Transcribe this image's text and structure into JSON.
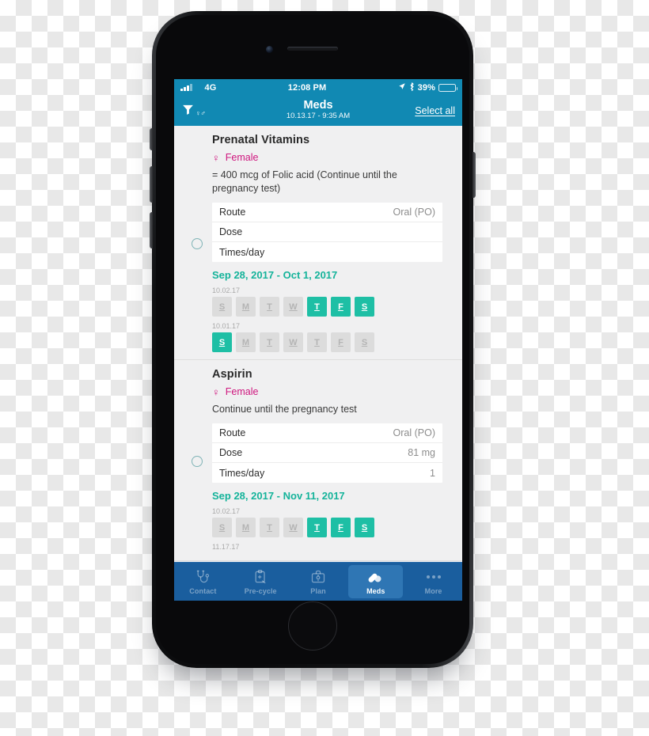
{
  "device": {
    "frame_name": "iphone-black"
  },
  "status_bar": {
    "signal_icon": "signal-bars-icon",
    "network": "4G",
    "time": "12:08 PM",
    "location_icon": "location-arrow-icon",
    "bluetooth_icon": "bluetooth-icon",
    "battery_percent": "39%",
    "battery_level": 39,
    "battery_icon": "battery-icon"
  },
  "nav_bar": {
    "filter_icon": "filter-funnel-icon",
    "gender_filter_glyphs": "♀♂",
    "title": "Meds",
    "subtitle": "10.13.17 - 9:35 AM",
    "select_all_label": "Select all",
    "background_color": "#1189b3"
  },
  "colors": {
    "header_blue": "#1189b3",
    "tab_blue": "#1a5e9e",
    "tab_active_blue": "#2f76b4",
    "teal": "#1ebfa5",
    "date_teal": "#14b39a",
    "pink": "#cf177f",
    "pill_off": "#dcdcdc",
    "screen_bg": "#f0f0f1"
  },
  "meds": [
    {
      "name": "Prenatal Vitamins",
      "gender_symbol": "♀",
      "gender_label": "Female",
      "note": "= 400 mcg of Folic acid (Continue until the pregnancy test)",
      "selected": false,
      "radio_icon": "radio-unchecked-icon",
      "details": [
        {
          "key": "Route",
          "value": "Oral (PO)"
        },
        {
          "key": "Dose",
          "value": ""
        },
        {
          "key": "Times/day",
          "value": ""
        }
      ],
      "date_range": "Sep 28, 2017 - Oct 1, 2017",
      "weeks": [
        {
          "date": "10.02.17",
          "days": [
            {
              "letter": "S",
              "active": false
            },
            {
              "letter": "M",
              "active": false
            },
            {
              "letter": "T",
              "active": false
            },
            {
              "letter": "W",
              "active": false
            },
            {
              "letter": "T",
              "active": true
            },
            {
              "letter": "F",
              "active": true
            },
            {
              "letter": "S",
              "active": true
            }
          ]
        },
        {
          "date": "10.01.17",
          "days": [
            {
              "letter": "S",
              "active": true
            },
            {
              "letter": "M",
              "active": false
            },
            {
              "letter": "T",
              "active": false
            },
            {
              "letter": "W",
              "active": false
            },
            {
              "letter": "T",
              "active": false
            },
            {
              "letter": "F",
              "active": false
            },
            {
              "letter": "S",
              "active": false
            }
          ]
        }
      ]
    },
    {
      "name": "Aspirin",
      "gender_symbol": "♀",
      "gender_label": "Female",
      "note": "Continue until the pregnancy test",
      "selected": false,
      "radio_icon": "radio-unchecked-icon",
      "details": [
        {
          "key": "Route",
          "value": "Oral (PO)"
        },
        {
          "key": "Dose",
          "value": "81 mg"
        },
        {
          "key": "Times/day",
          "value": "1"
        }
      ],
      "date_range": "Sep 28, 2017 - Nov 11, 2017",
      "weeks": [
        {
          "date": "10.02.17",
          "days": [
            {
              "letter": "S",
              "active": false
            },
            {
              "letter": "M",
              "active": false
            },
            {
              "letter": "T",
              "active": false
            },
            {
              "letter": "W",
              "active": false
            },
            {
              "letter": "T",
              "active": true
            },
            {
              "letter": "F",
              "active": true
            },
            {
              "letter": "S",
              "active": true
            }
          ]
        },
        {
          "date": "11.17.17",
          "days": []
        }
      ]
    }
  ],
  "tab_bar": [
    {
      "label": "Contact",
      "icon": "stethoscope-icon",
      "active": false
    },
    {
      "label": "Pre-cycle",
      "icon": "clipboard-icon",
      "active": false
    },
    {
      "label": "Plan",
      "icon": "briefcase-icon",
      "active": false
    },
    {
      "label": "Meds",
      "icon": "pills-icon",
      "active": true
    },
    {
      "label": "More",
      "icon": "ellipsis-icon",
      "active": false
    }
  ]
}
